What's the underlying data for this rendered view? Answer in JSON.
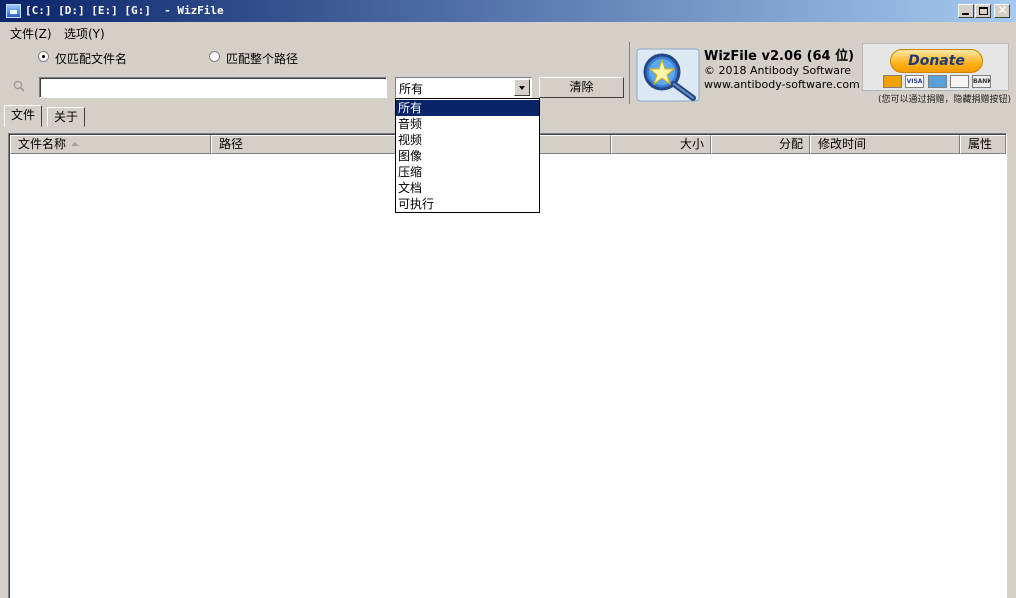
{
  "window": {
    "title": "[C:] [D:] [E:] [G:]  - WizFile"
  },
  "menu": {
    "file": "文件(Z)",
    "options": "选项(Y)"
  },
  "search": {
    "radio_filename": "仅匹配文件名",
    "radio_fullpath": "匹配整个路径",
    "selected_radio": "filename",
    "query": "",
    "filter_value": "所有",
    "clear_label": "清除"
  },
  "info": {
    "app_name": "WizFile v2.06 (64 位)",
    "copyright": "© 2018 Antibody Software",
    "url": "www.antibody-software.com",
    "donate_label": "Donate",
    "donate_note": "(您可以通过捐赠，隐藏捐赠按钮)"
  },
  "tabs": [
    "文件",
    "关于"
  ],
  "table": {
    "columns": [
      "文件名称",
      "路径",
      "大小",
      "分配",
      "修改时间",
      "属性"
    ],
    "rows": []
  },
  "dropdown": {
    "options": [
      "所有",
      "音频",
      "视频",
      "图像",
      "压缩",
      "文档",
      "可执行"
    ],
    "selected_index": 0
  },
  "colors": {
    "titlebar": "#0a246a",
    "selection": "#0a246a",
    "face": "#d4d0c8"
  },
  "icons": {
    "search": "search-icon",
    "logo": "magnifier-logo-icon"
  }
}
